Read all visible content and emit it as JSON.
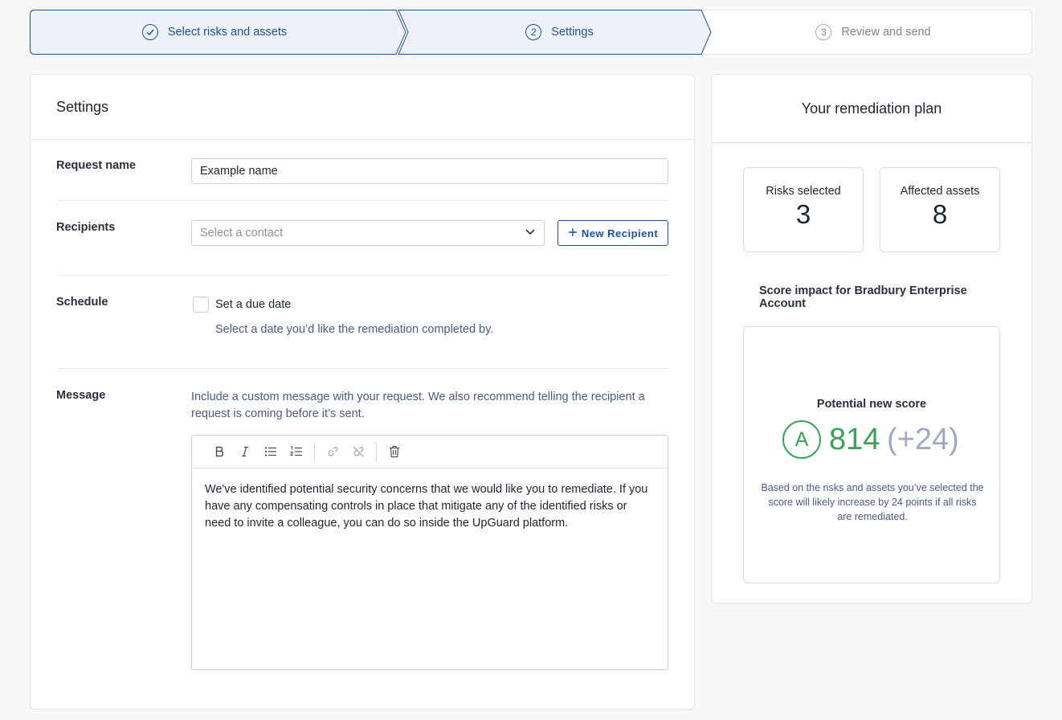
{
  "stepper": {
    "steps": [
      {
        "number": "✓",
        "label": "Select risks and assets",
        "state": "done"
      },
      {
        "number": "2",
        "label": "Settings",
        "state": "active"
      },
      {
        "number": "3",
        "label": "Review and send",
        "state": "pending"
      }
    ]
  },
  "settings": {
    "title": "Settings",
    "request_name": {
      "label": "Request name",
      "value": "Example name"
    },
    "recipients": {
      "label": "Recipients",
      "placeholder": "Select a contact",
      "new_button": "New Recipient"
    },
    "schedule": {
      "label": "Schedule",
      "checkbox_label": "Set a due date",
      "checked": false,
      "helper": "Select a date you’d like the remediation completed by."
    },
    "message": {
      "label": "Message",
      "helper": "Include a custom message with your request. We also recommend telling the recipient a request is coming before it’s sent.",
      "toolbar": [
        "bold-icon",
        "italic-icon",
        "bulleted-list-icon",
        "numbered-list-icon",
        "link-icon",
        "unlink-icon",
        "trash-icon"
      ],
      "body": "We've identified potential security concerns that we would like you to remediate. If you have any compensating controls in place that mitigate any of the identified risks or need to invite a colleague, you can do so inside the UpGuard platform."
    }
  },
  "plan": {
    "title": "Your remediation plan",
    "risks_selected": {
      "label": "Risks selected",
      "value": "3"
    },
    "affected_assets": {
      "label": "Affected assets",
      "value": "8"
    },
    "impact_title": "Score impact for Bradbury Enterprise Account",
    "score": {
      "label": "Potential new score",
      "grade": "A",
      "value": "814",
      "delta": "(+24)",
      "description": "Based on the risks and assets you’ve selected the score will likely increase by 24 points if all risks are remediated."
    }
  },
  "colors": {
    "primary": "#1d4f9c",
    "success": "#3aa25a",
    "muted": "#a2a8c0",
    "helper": "#4a5a86"
  }
}
